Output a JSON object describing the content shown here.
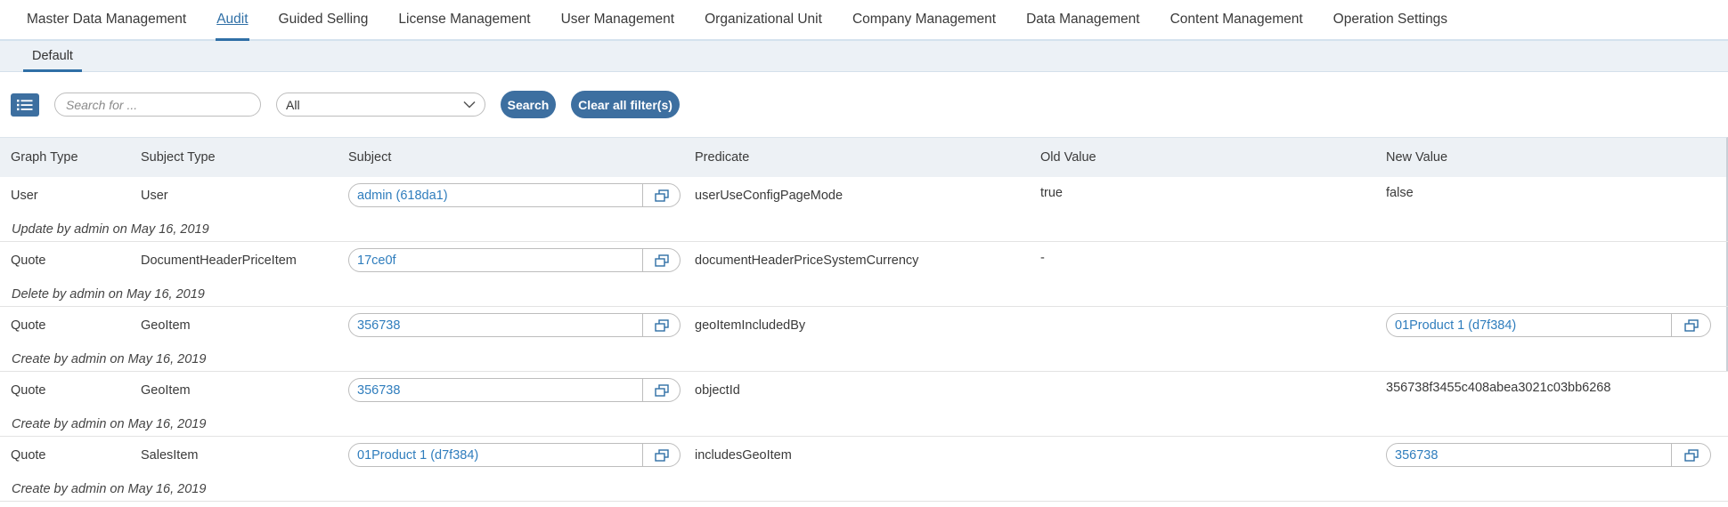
{
  "nav": {
    "items": [
      {
        "label": "Master Data Management",
        "active": false
      },
      {
        "label": "Audit",
        "active": true
      },
      {
        "label": "Guided Selling",
        "active": false
      },
      {
        "label": "License Management",
        "active": false
      },
      {
        "label": "User Management",
        "active": false
      },
      {
        "label": "Organizational Unit",
        "active": false
      },
      {
        "label": "Company Management",
        "active": false
      },
      {
        "label": "Data Management",
        "active": false
      },
      {
        "label": "Content Management",
        "active": false
      },
      {
        "label": "Operation Settings",
        "active": false
      }
    ]
  },
  "subtabs": {
    "default_label": "Default"
  },
  "toolbar": {
    "list_icon": "list-icon",
    "search_placeholder": "Search for ...",
    "filter_value": "All",
    "search_button": "Search",
    "clear_button": "Clear all filter(s)"
  },
  "table": {
    "headers": {
      "graph_type": "Graph Type",
      "subject_type": "Subject Type",
      "subject": "Subject",
      "predicate": "Predicate",
      "old_value": "Old Value",
      "new_value": "New Value"
    },
    "rows": [
      {
        "graph_type": "User",
        "subject_type": "User",
        "subject": "admin (618da1)",
        "predicate": "userUseConfigPageMode",
        "old_value": "true",
        "new_value": "false",
        "new_value_link": false,
        "meta": "Update by admin on May 16, 2019"
      },
      {
        "graph_type": "Quote",
        "subject_type": "DocumentHeaderPriceItem",
        "subject": "17ce0f",
        "predicate": "documentHeaderPriceSystemCurrency",
        "old_value": "-",
        "new_value": "",
        "new_value_link": false,
        "meta": "Delete by admin on May 16, 2019"
      },
      {
        "graph_type": "Quote",
        "subject_type": "GeoItem",
        "subject": "356738",
        "predicate": "geoItemIncludedBy",
        "old_value": "",
        "new_value": "01Product 1 (d7f384)",
        "new_value_link": true,
        "meta": "Create by admin on May 16, 2019"
      },
      {
        "graph_type": "Quote",
        "subject_type": "GeoItem",
        "subject": "356738",
        "predicate": "objectId",
        "old_value": "",
        "new_value": "356738f3455c408abea3021c03bb6268",
        "new_value_link": false,
        "meta": "Create by admin on May 16, 2019"
      },
      {
        "graph_type": "Quote",
        "subject_type": "SalesItem",
        "subject": "01Product 1 (d7f384)",
        "predicate": "includesGeoItem",
        "old_value": "",
        "new_value": "356738",
        "new_value_link": true,
        "meta": "Create by admin on May 16, 2019"
      }
    ]
  },
  "colors": {
    "accent": "#3d6fa0",
    "link": "#2f7dbd"
  }
}
